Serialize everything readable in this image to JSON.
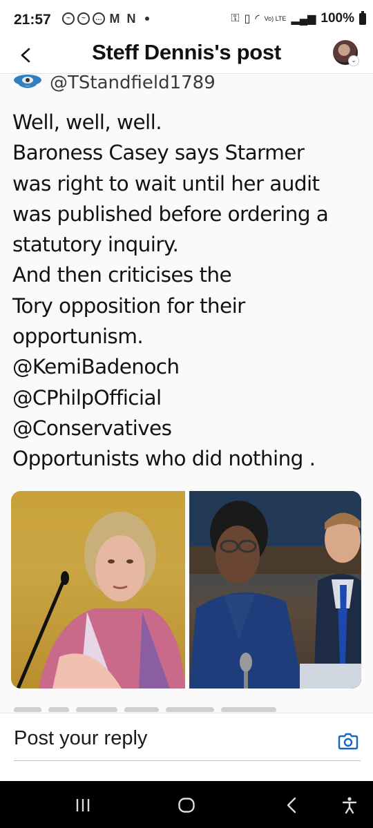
{
  "status_bar": {
    "time": "21:57",
    "notification_icons": [
      "messenger-icon",
      "messenger-icon",
      "chat-icon",
      "gmail-icon",
      "netflix-icon"
    ],
    "lte_label": "Vo) LTE",
    "battery_text": "100%"
  },
  "header": {
    "title": "Steff Dennis's post"
  },
  "post": {
    "handle": "@TStandfield1789",
    "text_lines": [
      "Well, well, well.",
      "Baroness Casey says Starmer",
      "was right to wait until her audit",
      "was published before ordering a",
      "statutory inquiry.",
      "And then criticises the",
      "Tory opposition for their",
      "opportunism.",
      "@KemiBadenoch",
      "@CPhilpOfficial",
      "@Conservatives",
      "Opportunists who did nothing ."
    ]
  },
  "reply": {
    "placeholder": "Post your reply"
  },
  "colors": {
    "accent": "#1565c0",
    "navbar": "#000000"
  }
}
